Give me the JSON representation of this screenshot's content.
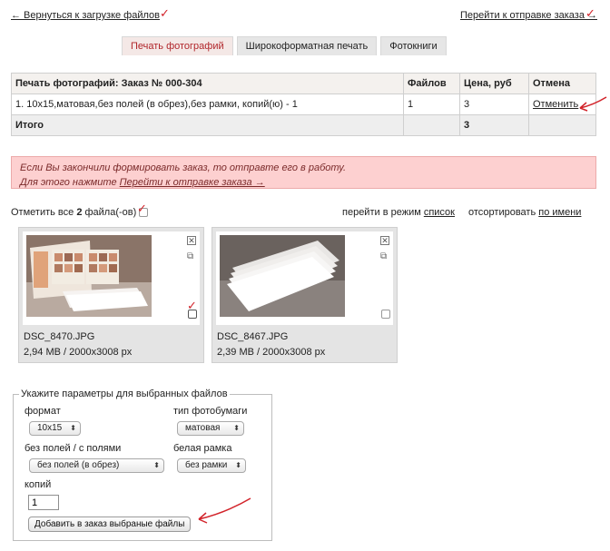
{
  "nav": {
    "back_label": "← Вернуться к загрузке файлов",
    "forward_label": "Перейти к отправке заказа →"
  },
  "tabs": [
    {
      "label": "Печать фотографий",
      "active": true
    },
    {
      "label": "Широкоформатная печать",
      "active": false
    },
    {
      "label": "Фотокниги",
      "active": false
    }
  ],
  "order": {
    "headers": [
      "Печать фотографий: Заказ № 000-304",
      "Файлов",
      "Цена, руб",
      "Отмена"
    ],
    "rows": [
      {
        "description": "1. 10х15,матовая,без полей (в обрез),без рамки, копий(ю) - 1",
        "files": "1",
        "price": "3",
        "cancel": "Отменить"
      }
    ],
    "total_label": "Итого",
    "total_price": "3"
  },
  "notice": {
    "line1": "Если Вы закончили формировать заказ, то отправте его в работу.",
    "line2_prefix": "Для этого нажмите ",
    "line2_link": "Перейти к отправке заказа →"
  },
  "files_bar": {
    "select_all_prefix": "Отметить все ",
    "select_all_count": "2",
    "select_all_suffix": " файла(-ов)",
    "view_prefix": "перейти в режим ",
    "view_link": "список",
    "sort_prefix": "отсортировать ",
    "sort_link": "по имени"
  },
  "files": [
    {
      "name": "DSC_8470.JPG",
      "size": "2,94 MB",
      "dims": "2000x3008 px",
      "checked": true
    },
    {
      "name": "DSC_8467.JPG",
      "size": "2,39 MB",
      "dims": "2000x3008 px",
      "checked": false
    }
  ],
  "params": {
    "legend": "Укажите параметры для выбранных файлов",
    "format_label": "формат",
    "format_value": "10x15",
    "paper_label": "тип фотобумаги",
    "paper_value": "матовая",
    "margins_label": "без полей / с полями",
    "margins_value": "без полей (в обрез)",
    "frame_label": "белая рамка",
    "frame_value": "без рамки",
    "copies_label": "копий",
    "copies_value": "1",
    "add_button": "Добавить в заказ выбраные файлы"
  },
  "icons": {
    "close": "close-icon",
    "copy": "copy-icon",
    "checkbox": "checkbox-icon",
    "dropdown": "chevron-updown-icon"
  },
  "colors": {
    "accent_red": "#d2232a",
    "active_tab_text": "#b1262b",
    "notice_bg": "#fdd0d0"
  }
}
